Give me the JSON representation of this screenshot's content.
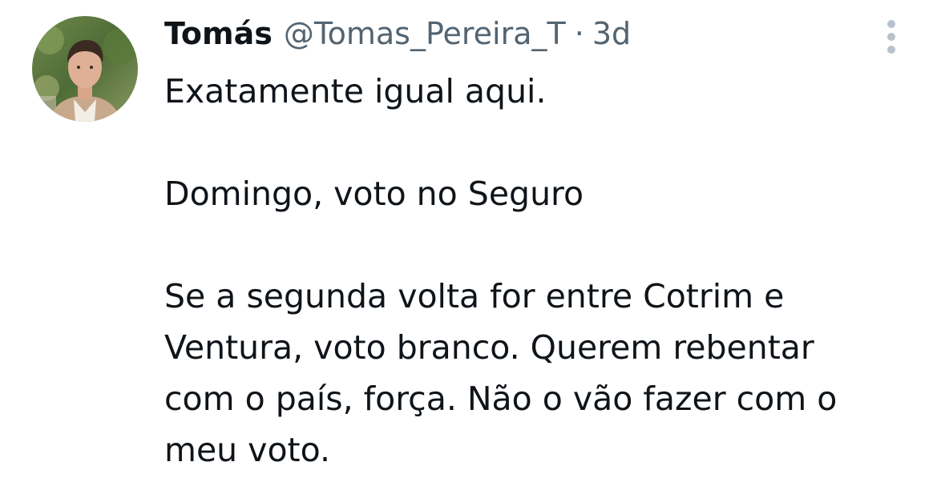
{
  "tweet": {
    "author": {
      "display_name": "Tomás",
      "handle": "@Tomas_Pereira_T",
      "avatar_icon": "profile-photo"
    },
    "separator": "·",
    "timestamp": "3d",
    "more_icon": "more-vertical-icon",
    "paragraphs": [
      "Exatamente igual aqui.",
      "Domingo, voto no Seguro",
      "Se a segunda volta for entre Cotrim e\nVentura, voto branco. Querem rebentar\ncom o país, força. Não o vão fazer com o\nmeu voto."
    ]
  },
  "colors": {
    "text_primary": "#0f1419",
    "text_secondary": "#536471",
    "icon_gray": "#b9c2ca",
    "background": "#ffffff"
  }
}
